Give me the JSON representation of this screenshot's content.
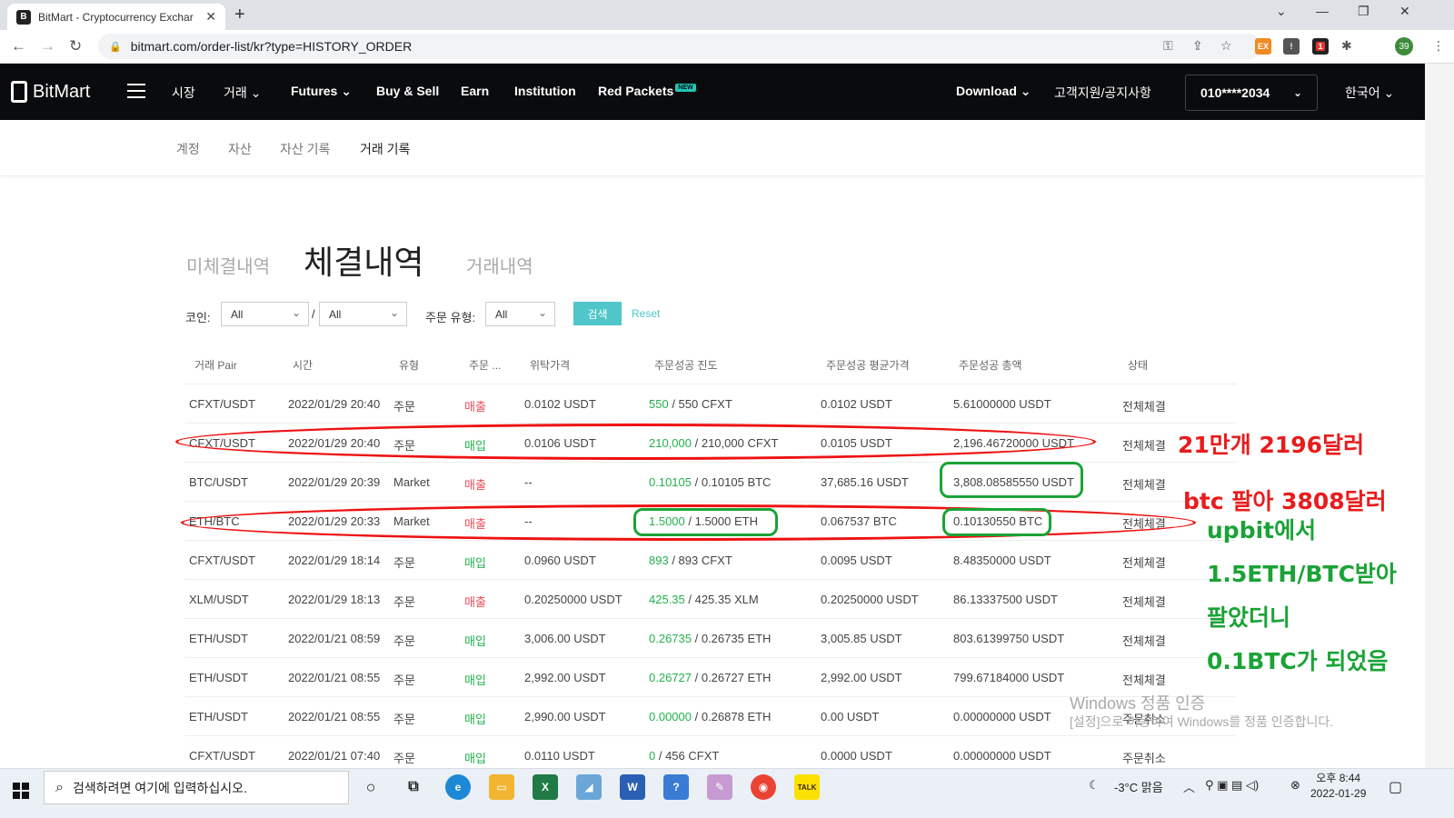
{
  "browser": {
    "tab_title": "BitMart - Cryptocurrency Exchar",
    "tab_close": "✕",
    "new_tab": "+",
    "url": "bitmart.com/order-list/kr?type=HISTORY_ORDER",
    "profile_count": "39",
    "ext_badge": "1"
  },
  "header": {
    "logo_text": "BitMart",
    "nav": [
      "시장",
      "거래",
      "Futures",
      "Buy & Sell",
      "Earn",
      "Institution",
      "Red Packets"
    ],
    "new_badge": "NEW",
    "download": "Download",
    "support": "고객지원/공지사항",
    "account": "010****2034",
    "language": "한국어"
  },
  "subnav": [
    "계정",
    "자산",
    "자산 기록",
    "거래 기록"
  ],
  "order_tabs": [
    "미체결내역",
    "체결내역",
    "거래내역"
  ],
  "filters": {
    "coin_label": "코인:",
    "coin_value": "All",
    "slash": "/",
    "quote_value": "All",
    "type_label": "주문 유형:",
    "type_value": "All",
    "search_label": "검색",
    "reset_label": "Reset"
  },
  "table": {
    "headers": [
      "거래 Pair",
      "시간",
      "유형",
      "주문 ...",
      "위탁가격",
      "주문성공 진도",
      "주문성공 평균가격",
      "주문성공 총액",
      "상태"
    ],
    "rows": [
      {
        "pair": "CFXT/USDT",
        "time": "2022/01/29 20:40",
        "type": "주문",
        "side": "매출",
        "price": "0.0102 USDT",
        "filled": "550",
        "total_qty": " / 550 CFXT",
        "avg": "0.0102 USDT",
        "amount": "5.61000000 USDT",
        "status": "전체체결"
      },
      {
        "pair": "CFXT/USDT",
        "time": "2022/01/29 20:40",
        "type": "주문",
        "side": "매입",
        "price": "0.0106 USDT",
        "filled": "210,000",
        "total_qty": " / 210,000 CFXT",
        "avg": "0.0105 USDT",
        "amount": "2,196.46720000 USDT",
        "status": "전체체결"
      },
      {
        "pair": "BTC/USDT",
        "time": "2022/01/29 20:39",
        "type": "Market",
        "side": "매출",
        "price": "--",
        "filled": "0.10105",
        "total_qty": " / 0.10105 BTC",
        "avg": "37,685.16 USDT",
        "amount": "3,808.08585550 USDT",
        "status": "전체체결"
      },
      {
        "pair": "ETH/BTC",
        "time": "2022/01/29 20:33",
        "type": "Market",
        "side": "매출",
        "price": "--",
        "filled": "1.5000",
        "total_qty": " / 1.5000 ETH",
        "avg": "0.067537 BTC",
        "amount": "0.10130550 BTC",
        "status": "전체체결"
      },
      {
        "pair": "CFXT/USDT",
        "time": "2022/01/29 18:14",
        "type": "주문",
        "side": "매입",
        "price": "0.0960 USDT",
        "filled": "893",
        "total_qty": " / 893 CFXT",
        "avg": "0.0095 USDT",
        "amount": "8.48350000 USDT",
        "status": "전체체결"
      },
      {
        "pair": "XLM/USDT",
        "time": "2022/01/29 18:13",
        "type": "주문",
        "side": "매출",
        "price": "0.20250000 USDT",
        "filled": "425.35",
        "total_qty": " / 425.35 XLM",
        "avg": "0.20250000 USDT",
        "amount": "86.13337500 USDT",
        "status": "전체체결"
      },
      {
        "pair": "ETH/USDT",
        "time": "2022/01/21 08:59",
        "type": "주문",
        "side": "매입",
        "price": "3,006.00 USDT",
        "filled": "0.26735",
        "total_qty": " / 0.26735 ETH",
        "avg": "3,005.85 USDT",
        "amount": "803.61399750 USDT",
        "status": "전체체결"
      },
      {
        "pair": "ETH/USDT",
        "time": "2022/01/21 08:55",
        "type": "주문",
        "side": "매입",
        "price": "2,992.00 USDT",
        "filled": "0.26727",
        "total_qty": " / 0.26727 ETH",
        "avg": "2,992.00 USDT",
        "amount": "799.67184000 USDT",
        "status": "전체체결"
      },
      {
        "pair": "ETH/USDT",
        "time": "2022/01/21 08:55",
        "type": "주문",
        "side": "매입",
        "price": "2,990.00 USDT",
        "filled": "0.00000",
        "total_qty": " / 0.26878 ETH",
        "avg": "0.00 USDT",
        "amount": "0.00000000 USDT",
        "status": "주문취소"
      },
      {
        "pair": "CFXT/USDT",
        "time": "2022/01/21 07:40",
        "type": "주문",
        "side": "매입",
        "price": "0.0110 USDT",
        "filled": "0",
        "total_qty": " / 456 CFXT",
        "avg": "0.0000 USDT",
        "amount": "0.00000000 USDT",
        "status": "주문취소"
      }
    ]
  },
  "annotations": {
    "note1": "21만개 2196달러",
    "note2": "btc 팔아 3808달러",
    "note3": "upbit에서",
    "note4": "1.5ETH/BTC받아",
    "note5": "팔았더니",
    "note6": "0.1BTC가 되었음"
  },
  "watermark": {
    "line1": "Windows 정품 인증",
    "line2": "[설정]으로 이동하여 Windows를 정품 인증합니다."
  },
  "taskbar": {
    "search_placeholder": "검색하려면 여기에 입력하십시오.",
    "weather": "-3°C  맑음",
    "time": "오후 8:44",
    "date": "2022-01-29"
  },
  "colors": {
    "buy": "#22b14c",
    "sell": "#ee4c56",
    "accent": "#4fc6c9",
    "annotation_red": "#e81c1c",
    "annotation_green": "#1aa336"
  }
}
